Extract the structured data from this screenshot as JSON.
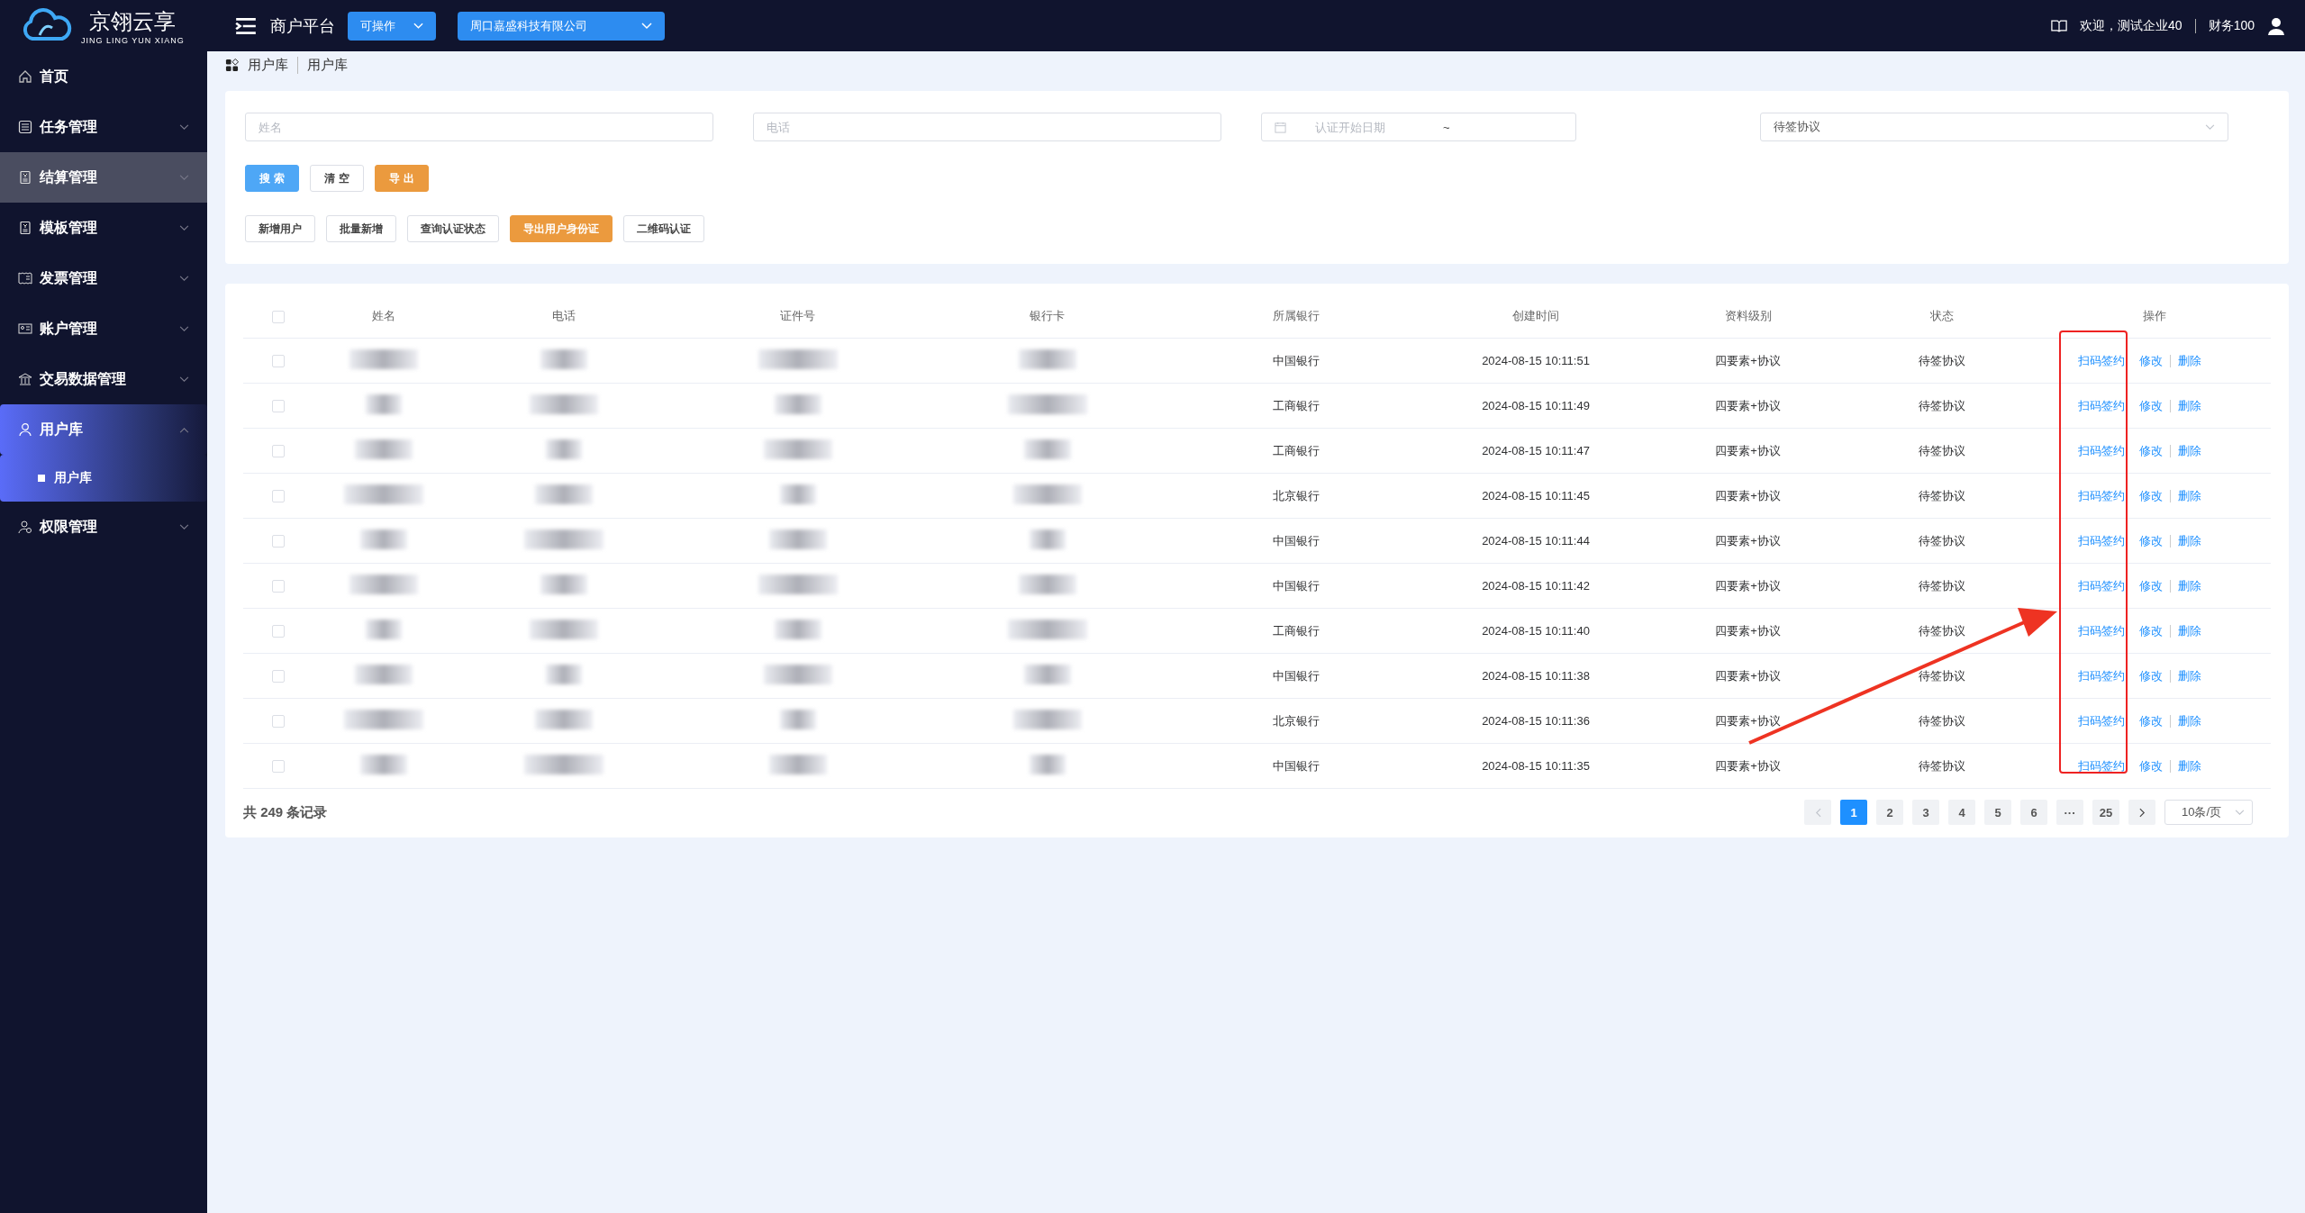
{
  "brand": {
    "name": "京翎云享",
    "subtitle": "JING LING YUN XIANG"
  },
  "topbar": {
    "platform": "商户平台",
    "status_select": "可操作",
    "company_select": "周口嘉盛科技有限公司",
    "welcome": "欢迎，测试企业40",
    "user": "财务100"
  },
  "sidebar": {
    "items": [
      {
        "label": "首页",
        "expandable": false,
        "selected": false,
        "hovered": false
      },
      {
        "label": "任务管理",
        "expandable": true,
        "expanded": false,
        "selected": false,
        "hovered": false
      },
      {
        "label": "结算管理",
        "expandable": true,
        "expanded": false,
        "selected": false,
        "hovered": true
      },
      {
        "label": "模板管理",
        "expandable": true,
        "expanded": false,
        "selected": false,
        "hovered": false
      },
      {
        "label": "发票管理",
        "expandable": true,
        "expanded": false,
        "selected": false,
        "hovered": false
      },
      {
        "label": "账户管理",
        "expandable": true,
        "expanded": false,
        "selected": false,
        "hovered": false
      },
      {
        "label": "交易数据管理",
        "expandable": true,
        "expanded": false,
        "selected": false,
        "hovered": false
      },
      {
        "label": "用户库",
        "expandable": true,
        "expanded": true,
        "selected": true,
        "hovered": false,
        "children": [
          {
            "label": "用户库",
            "selected": true
          }
        ]
      },
      {
        "label": "权限管理",
        "expandable": true,
        "expanded": false,
        "selected": false,
        "hovered": false
      }
    ]
  },
  "breadcrumb": [
    "用户库",
    "用户库"
  ],
  "filters": {
    "name": {
      "placeholder": "姓名"
    },
    "phone": {
      "placeholder": "电话"
    },
    "date_start": {
      "placeholder": "认证开始日期"
    },
    "date_separator": "~",
    "status": {
      "value": "待签协议"
    }
  },
  "buttons": [
    {
      "label": "搜 索",
      "kind": "primary"
    },
    {
      "label": "清 空",
      "kind": "plain"
    },
    {
      "label": "导 出",
      "kind": "warning"
    }
  ],
  "actions": [
    {
      "label": "新增用户",
      "kind": "plain"
    },
    {
      "label": "批量新增",
      "kind": "plain"
    },
    {
      "label": "查询认证状态",
      "kind": "plain"
    },
    {
      "label": "导出用户身份证",
      "kind": "warning"
    },
    {
      "label": "二维码认证",
      "kind": "plain"
    }
  ],
  "table": {
    "header_checked": false,
    "columns": [
      "姓名",
      "电话",
      "证件号",
      "银行卡",
      "所属银行",
      "创建时间",
      "资料级别",
      "状态",
      "操作"
    ],
    "rows": [
      {
        "checked": false,
        "bank": "中国银行",
        "created": "2024-08-15 10:11:51",
        "level": "四要素+协议",
        "status": "待签协议",
        "ops": [
          "扫码签约",
          "修改",
          "删除"
        ]
      },
      {
        "checked": false,
        "bank": "工商银行",
        "created": "2024-08-15 10:11:49",
        "level": "四要素+协议",
        "status": "待签协议",
        "ops": [
          "扫码签约",
          "修改",
          "删除"
        ]
      },
      {
        "checked": false,
        "bank": "工商银行",
        "created": "2024-08-15 10:11:47",
        "level": "四要素+协议",
        "status": "待签协议",
        "ops": [
          "扫码签约",
          "修改",
          "删除"
        ]
      },
      {
        "checked": false,
        "bank": "北京银行",
        "created": "2024-08-15 10:11:45",
        "level": "四要素+协议",
        "status": "待签协议",
        "ops": [
          "扫码签约",
          "修改",
          "删除"
        ]
      },
      {
        "checked": false,
        "bank": "中国银行",
        "created": "2024-08-15 10:11:44",
        "level": "四要素+协议",
        "status": "待签协议",
        "ops": [
          "扫码签约",
          "修改",
          "删除"
        ]
      },
      {
        "checked": false,
        "bank": "中国银行",
        "created": "2024-08-15 10:11:42",
        "level": "四要素+协议",
        "status": "待签协议",
        "ops": [
          "扫码签约",
          "修改",
          "删除"
        ]
      },
      {
        "checked": false,
        "bank": "工商银行",
        "created": "2024-08-15 10:11:40",
        "level": "四要素+协议",
        "status": "待签协议",
        "ops": [
          "扫码签约",
          "修改",
          "删除"
        ]
      },
      {
        "checked": false,
        "bank": "中国银行",
        "created": "2024-08-15 10:11:38",
        "level": "四要素+协议",
        "status": "待签协议",
        "ops": [
          "扫码签约",
          "修改",
          "删除"
        ]
      },
      {
        "checked": false,
        "bank": "北京银行",
        "created": "2024-08-15 10:11:36",
        "level": "四要素+协议",
        "status": "待签协议",
        "ops": [
          "扫码签约",
          "修改",
          "删除"
        ]
      },
      {
        "checked": false,
        "bank": "中国银行",
        "created": "2024-08-15 10:11:35",
        "level": "四要素+协议",
        "status": "待签协议",
        "ops": [
          "扫码签约",
          "修改",
          "删除"
        ]
      }
    ]
  },
  "pagination": {
    "total": "共 249 条记录",
    "pages": [
      {
        "label": "1",
        "selected": true
      },
      {
        "label": "2",
        "selected": false
      },
      {
        "label": "3",
        "selected": false
      },
      {
        "label": "4",
        "selected": false
      },
      {
        "label": "5",
        "selected": false
      },
      {
        "label": "6",
        "selected": false
      },
      {
        "label": "···",
        "selected": false
      },
      {
        "label": "25",
        "selected": false
      }
    ],
    "page_size": "10条/页"
  }
}
